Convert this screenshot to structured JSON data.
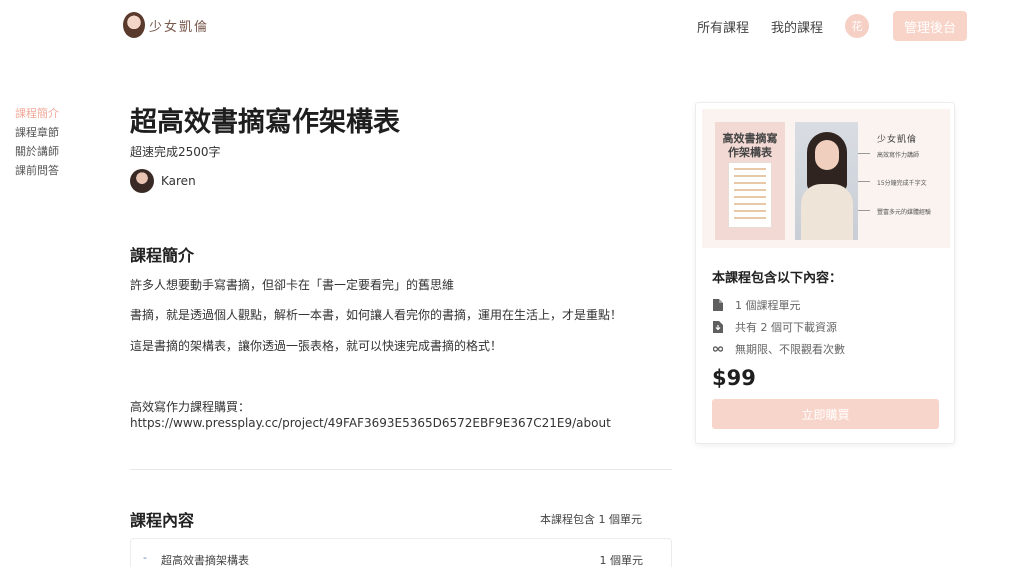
{
  "header": {
    "brand": "少女凱倫",
    "nav": [
      "所有課程",
      "我的課程"
    ],
    "user_initial": "花",
    "admin_label": "管理後台"
  },
  "side_nav": [
    {
      "label": "課程簡介",
      "active": true
    },
    {
      "label": "課程章節",
      "active": false
    },
    {
      "label": "關於講師",
      "active": false
    },
    {
      "label": "課前問答",
      "active": false
    }
  ],
  "course": {
    "title": "超高效書摘寫作架構表",
    "subtitle": "超速完成2500字",
    "instructor": "Karen"
  },
  "intro": {
    "heading": "課程簡介",
    "paragraphs": [
      "許多人想要動手寫書摘，但卻卡在「書一定要看完」的舊思維",
      "書摘，就是透過個人觀點，解析一本書，如何讓人看完你的書摘，運用在生活上，才是重點！",
      "這是書摘的架構表，讓你透過一張表格，就可以快速完成書摘的格式！"
    ],
    "purchase_label": "高效寫作力課程購買：",
    "purchase_url": "https://www.pressplay.cc/project/49FAF3693E5365D6572EBF9E367C21E9/about"
  },
  "content": {
    "heading": "課程內容",
    "summary": "本課程包含 1 個單元",
    "chapters": [
      {
        "title": "超高效書摘架構表",
        "units": "1 個單元"
      }
    ]
  },
  "card": {
    "thumb": {
      "title": "高效書摘寫作架構表",
      "brand": "少女凱倫",
      "notes": [
        "高效寫作力講師",
        "15分鐘完成千字文",
        "豐富多元的媒體經驗"
      ]
    },
    "heading": "本課程包含以下內容：",
    "features": [
      {
        "icon": "document-icon",
        "label": "1 個課程單元"
      },
      {
        "icon": "download-file-icon",
        "label": "共有 2 個可下載資源"
      },
      {
        "icon": "infinity-icon",
        "label": "無期限、不限觀看次數"
      }
    ],
    "price": "$99",
    "buy_label": "立即購買"
  },
  "colors": {
    "accent": "#f8d3c8",
    "active_nav": "#f0a898"
  }
}
